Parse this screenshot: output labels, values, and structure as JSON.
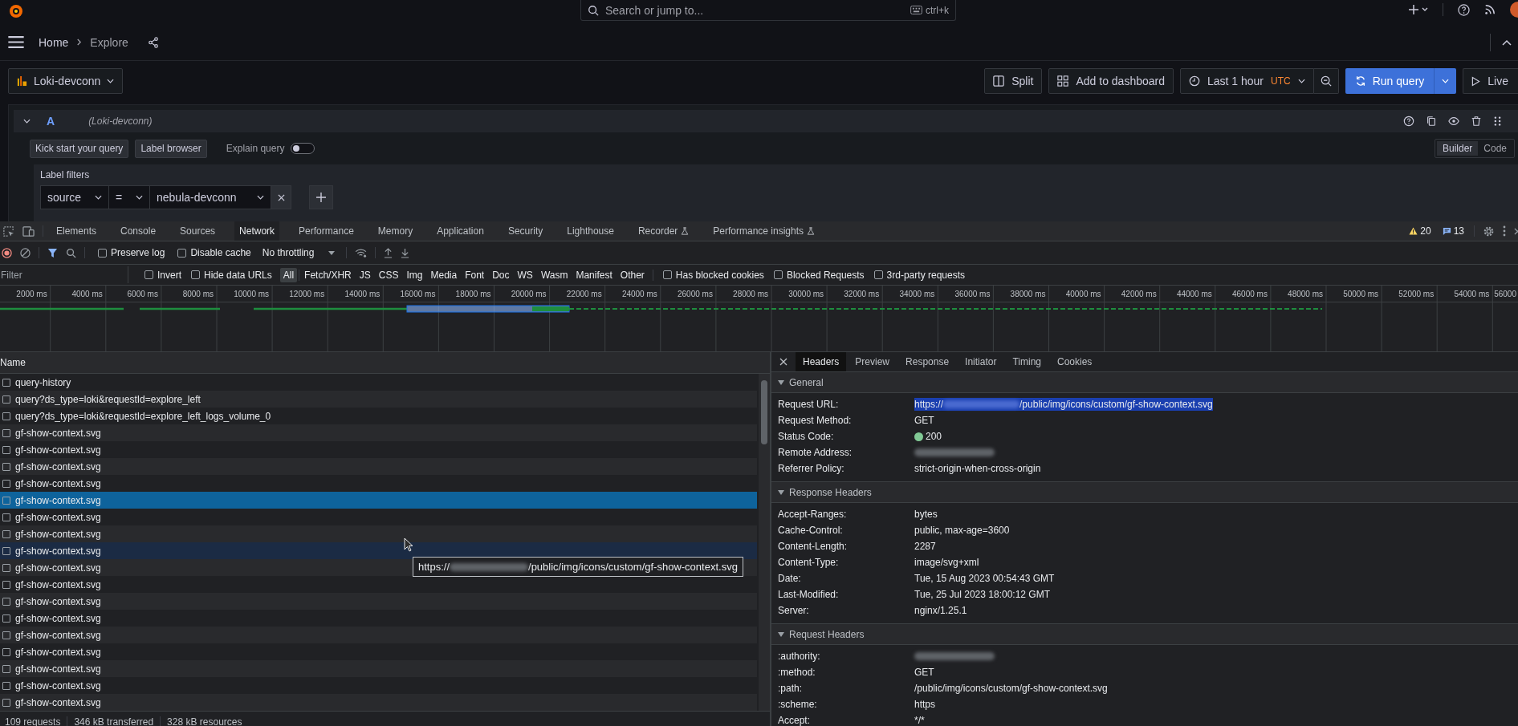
{
  "topbar": {
    "search_placeholder": "Search or jump to...",
    "shortcut": "ctrl+k"
  },
  "breadcrumbs": [
    "Home",
    "Explore"
  ],
  "explore_toolbar": {
    "datasource": "Loki-devconn",
    "split": "Split",
    "add_to_dashboard": "Add to dashboard",
    "time_range": "Last 1 hour",
    "timezone": "UTC",
    "run_button": "Run query",
    "live_button": "Live"
  },
  "query": {
    "ref": "A",
    "datasource": "(Loki-devconn)",
    "buttons": [
      "Kick start your query",
      "Label browser"
    ],
    "explain": {
      "label": "Explain query",
      "on": false
    },
    "modes": [
      {
        "label": "Builder",
        "selected": true
      },
      {
        "label": "Code",
        "selected": false
      }
    ],
    "label_filters_title": "Label filters",
    "filter": {
      "label": "source",
      "operator": "=",
      "value": "nebula-devconn"
    }
  },
  "devtools": {
    "tabs": [
      {
        "label": "Elements",
        "selected": false,
        "experimental": false
      },
      {
        "label": "Console",
        "selected": false,
        "experimental": false
      },
      {
        "label": "Sources",
        "selected": false,
        "experimental": false
      },
      {
        "label": "Network",
        "selected": true,
        "experimental": false
      },
      {
        "label": "Performance",
        "selected": false,
        "experimental": false
      },
      {
        "label": "Memory",
        "selected": false,
        "experimental": false
      },
      {
        "label": "Application",
        "selected": false,
        "experimental": false
      },
      {
        "label": "Security",
        "selected": false,
        "experimental": false
      },
      {
        "label": "Lighthouse",
        "selected": false,
        "experimental": false
      },
      {
        "label": "Recorder",
        "selected": false,
        "experimental": true
      },
      {
        "label": "Performance insights",
        "selected": false,
        "experimental": true
      }
    ],
    "warnings": "20",
    "messages": "13"
  },
  "network_toolbar": {
    "options": [
      {
        "label": "Preserve log",
        "checked": false
      },
      {
        "label": "Disable cache",
        "checked": false
      }
    ],
    "throttling": "No throttling"
  },
  "filter_bar": {
    "placeholder": "Filter",
    "options": [
      {
        "label": "Invert",
        "checked": false
      },
      {
        "label": "Hide data URLs",
        "checked": false
      }
    ],
    "types": [
      {
        "label": "All",
        "selected": true
      },
      {
        "label": "Fetch/XHR",
        "selected": false
      },
      {
        "label": "JS",
        "selected": false
      },
      {
        "label": "CSS",
        "selected": false
      },
      {
        "label": "Img",
        "selected": false
      },
      {
        "label": "Media",
        "selected": false
      },
      {
        "label": "Font",
        "selected": false
      },
      {
        "label": "Doc",
        "selected": false
      },
      {
        "label": "WS",
        "selected": false
      },
      {
        "label": "Wasm",
        "selected": false
      },
      {
        "label": "Manifest",
        "selected": false
      },
      {
        "label": "Other",
        "selected": false
      }
    ],
    "extra_options": [
      {
        "label": "Has blocked cookies",
        "checked": false
      },
      {
        "label": "Blocked Requests",
        "checked": false
      },
      {
        "label": "3rd-party requests",
        "checked": false
      }
    ]
  },
  "timeline": {
    "ticks": [
      "2000 ms",
      "4000 ms",
      "6000 ms",
      "8000 ms",
      "10000 ms",
      "12000 ms",
      "14000 ms",
      "16000 ms",
      "18000 ms",
      "20000 ms",
      "22000 ms",
      "24000 ms",
      "26000 ms",
      "28000 ms",
      "30000 ms",
      "32000 ms",
      "34000 ms",
      "36000 ms",
      "38000 ms",
      "40000 ms",
      "42000 ms",
      "44000 ms",
      "46000 ms",
      "48000 ms",
      "50000 ms",
      "52000 ms",
      "54000 ms",
      "56000"
    ]
  },
  "requests": {
    "column": "Name",
    "rows": [
      {
        "name": "query-history",
        "selected": false,
        "hovered": false
      },
      {
        "name": "query?ds_type=loki&requestId=explore_left",
        "selected": false,
        "hovered": false
      },
      {
        "name": "query?ds_type=loki&requestId=explore_left_logs_volume_0",
        "selected": false,
        "hovered": false
      },
      {
        "name": "gf-show-context.svg",
        "selected": false,
        "hovered": false
      },
      {
        "name": "gf-show-context.svg",
        "selected": false,
        "hovered": false
      },
      {
        "name": "gf-show-context.svg",
        "selected": false,
        "hovered": false
      },
      {
        "name": "gf-show-context.svg",
        "selected": false,
        "hovered": false
      },
      {
        "name": "gf-show-context.svg",
        "selected": true,
        "hovered": false
      },
      {
        "name": "gf-show-context.svg",
        "selected": false,
        "hovered": false
      },
      {
        "name": "gf-show-context.svg",
        "selected": false,
        "hovered": false
      },
      {
        "name": "gf-show-context.svg",
        "selected": false,
        "hovered": true
      },
      {
        "name": "gf-show-context.svg",
        "selected": false,
        "hovered": false
      },
      {
        "name": "gf-show-context.svg",
        "selected": false,
        "hovered": false
      },
      {
        "name": "gf-show-context.svg",
        "selected": false,
        "hovered": false
      },
      {
        "name": "gf-show-context.svg",
        "selected": false,
        "hovered": false
      },
      {
        "name": "gf-show-context.svg",
        "selected": false,
        "hovered": false
      },
      {
        "name": "gf-show-context.svg",
        "selected": false,
        "hovered": false
      },
      {
        "name": "gf-show-context.svg",
        "selected": false,
        "hovered": false
      },
      {
        "name": "gf-show-context.svg",
        "selected": false,
        "hovered": false
      },
      {
        "name": "gf-show-context.svg",
        "selected": false,
        "hovered": false
      }
    ],
    "tooltip": {
      "prefix": "https://",
      "suffix": "/public/img/icons/custom/gf-show-context.svg"
    },
    "summary": [
      "109 requests",
      "346 kB transferred",
      "328 kB resources"
    ]
  },
  "details": {
    "tabs": [
      {
        "label": "Headers",
        "selected": true
      },
      {
        "label": "Preview",
        "selected": false
      },
      {
        "label": "Response",
        "selected": false
      },
      {
        "label": "Initiator",
        "selected": false
      },
      {
        "label": "Timing",
        "selected": false
      },
      {
        "label": "Cookies",
        "selected": false
      }
    ],
    "sections": [
      {
        "title": "General",
        "expanded": true,
        "rows": [
          {
            "name": "Request URL:",
            "kind": "url",
            "prefix": "https://",
            "suffix": "/public/img/icons/custom/gf-show-context.svg",
            "highlighted": true
          },
          {
            "name": "Request Method:",
            "kind": "text",
            "value": "GET"
          },
          {
            "name": "Status Code:",
            "kind": "status",
            "value": "200"
          },
          {
            "name": "Remote Address:",
            "kind": "redacted"
          },
          {
            "name": "Referrer Policy:",
            "kind": "text",
            "value": "strict-origin-when-cross-origin"
          }
        ]
      },
      {
        "title": "Response Headers",
        "expanded": true,
        "rows": [
          {
            "name": "Accept-Ranges:",
            "kind": "text",
            "value": "bytes"
          },
          {
            "name": "Cache-Control:",
            "kind": "text",
            "value": "public, max-age=3600"
          },
          {
            "name": "Content-Length:",
            "kind": "text",
            "value": "2287"
          },
          {
            "name": "Content-Type:",
            "kind": "text",
            "value": "image/svg+xml"
          },
          {
            "name": "Date:",
            "kind": "text",
            "value": "Tue, 15 Aug 2023 00:54:43 GMT"
          },
          {
            "name": "Last-Modified:",
            "kind": "text",
            "value": "Tue, 25 Jul 2023 18:00:12 GMT"
          },
          {
            "name": "Server:",
            "kind": "text",
            "value": "nginx/1.25.1"
          }
        ]
      },
      {
        "title": "Request Headers",
        "expanded": true,
        "rows": [
          {
            "name": ":authority:",
            "kind": "redacted"
          },
          {
            "name": ":method:",
            "kind": "text",
            "value": "GET"
          },
          {
            "name": ":path:",
            "kind": "text",
            "value": "/public/img/icons/custom/gf-show-context.svg"
          },
          {
            "name": ":scheme:",
            "kind": "text",
            "value": "https"
          },
          {
            "name": "Accept:",
            "kind": "text",
            "value": "*/*"
          }
        ]
      }
    ]
  }
}
